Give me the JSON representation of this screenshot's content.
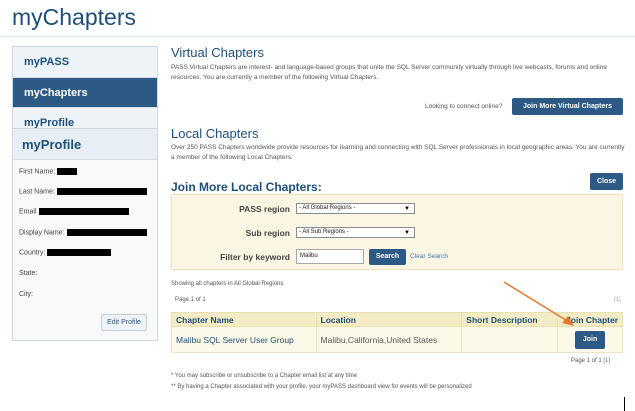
{
  "page": {
    "title": "myChapters"
  },
  "nav": {
    "items": [
      {
        "label": "myPASS"
      },
      {
        "label": "myChapters",
        "active": true
      },
      {
        "label": "myProfile"
      }
    ]
  },
  "profile": {
    "heading": "myProfile",
    "fields": {
      "first_name": "First Name:",
      "last_name": "Last Name:",
      "email": "Email",
      "display_name": "Display Name:",
      "country": "Country:",
      "state": "State:",
      "city": "City:"
    },
    "edit_label": "Edit Profile"
  },
  "virtual": {
    "heading": "Virtual Chapters",
    "description": "PASS Virtual Chapters are interest- and language-based groups that unite the SQL Server community virtually through live webcasts, forums and online resources. You are currently a member of the following Virtual Chapters.",
    "prompt": "Looking to connect online?",
    "button": "Join More Virtual Chapters"
  },
  "local": {
    "heading": "Local Chapters",
    "description": "Over 250 PASS Chapters worldwide provide resources for learning and connecting with SQL Server professionals in local geographic areas. You are currently a member of the following Local Chapters:",
    "join_heading": "Join More Local Chapters:",
    "close": "Close"
  },
  "filters": {
    "region_label": "PASS region",
    "region_value": "- All Global Regions -",
    "subregion_label": "Sub region",
    "subregion_value": "- All Sub Regions -",
    "keyword_label": "Filter by keyword",
    "keyword_value": "Malibu",
    "search": "Search",
    "clear": "Clear Search"
  },
  "results": {
    "showing": "Showing all chapters in All Global Regions",
    "page_top": "Page 1 of 1",
    "page_top_right": "[1]",
    "columns": [
      "Chapter Name",
      "Location",
      "Short Description",
      "Join Chapter"
    ],
    "rows": [
      {
        "name": "Malibu SQL Server User Group",
        "location": "Malibu,California,United States",
        "description": "",
        "join": "Join"
      }
    ],
    "page_bottom": "Page 1 of 1",
    "page_bottom_link": "[1]"
  },
  "footnotes": {
    "one": "* You may subscribe or unsubscribe to a Chapter email list at any time",
    "two": "** By having a Chapter associated with your profile, your myPASS dashboard view for events will be personalized"
  },
  "colors": {
    "accent": "#2c5a85",
    "join": "#2c5a85",
    "arrow": "#e8772e",
    "panel": "#fbf6e4"
  }
}
